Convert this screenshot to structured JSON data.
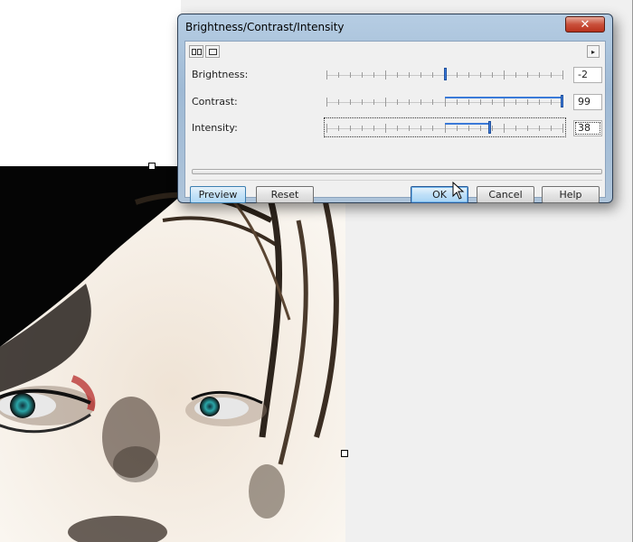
{
  "dialog": {
    "title": "Brightness/Contrast/Intensity",
    "close_label": "✕",
    "toolbar": {
      "split_view_icon": "split-view-icon",
      "single_view_icon": "single-view-icon",
      "expand_icon": "▸"
    },
    "sliders": [
      {
        "label": "Brightness:",
        "value": "-2",
        "level": 0.5
      },
      {
        "label": "Contrast:",
        "value": "99",
        "level": 1.0
      },
      {
        "label": "Intensity:",
        "value": "38",
        "level": 0.69
      }
    ],
    "buttons": {
      "preview": "Preview",
      "reset": "Reset",
      "ok": "OK",
      "cancel": "Cancel",
      "help": "Help"
    }
  },
  "colors": {
    "accent": "#3d7ee0",
    "close": "#c9503b",
    "title_bar": "#aec4da"
  }
}
